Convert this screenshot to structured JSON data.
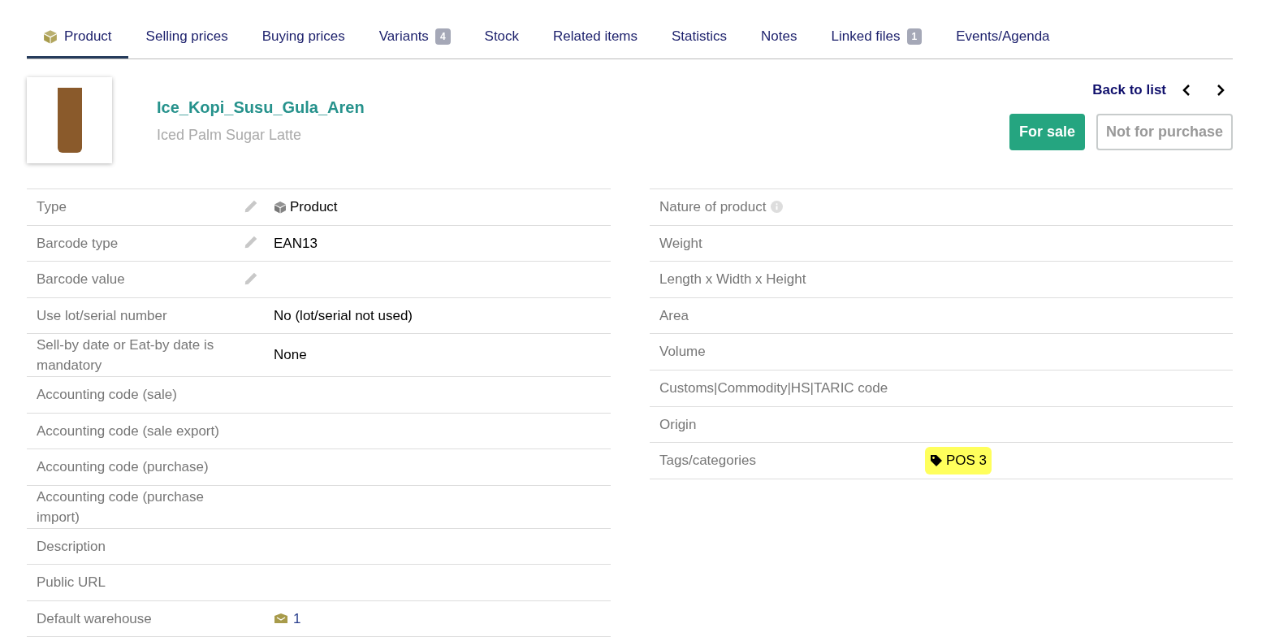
{
  "tabs": [
    {
      "label": "Product",
      "selected": true
    },
    {
      "label": "Selling prices",
      "selected": false
    },
    {
      "label": "Buying prices",
      "selected": false
    },
    {
      "label": "Variants",
      "badge": "4",
      "selected": false
    },
    {
      "label": "Stock",
      "selected": false
    },
    {
      "label": "Related items",
      "selected": false
    },
    {
      "label": "Statistics",
      "selected": false
    },
    {
      "label": "Notes",
      "selected": false
    },
    {
      "label": "Linked files",
      "badge": "1",
      "selected": false
    },
    {
      "label": "Events/Agenda",
      "selected": false
    }
  ],
  "product": {
    "ref": "Ice_Kopi_Susu_Gula_Aren",
    "label": "Iced Palm Sugar Latte"
  },
  "nav": {
    "back": "Back to list"
  },
  "status": [
    {
      "label": "For sale",
      "on": true
    },
    {
      "label": "Not for purchase",
      "on": false
    }
  ],
  "left_fields": [
    {
      "label": "Type",
      "editable": true,
      "kind": "type",
      "value": "Product"
    },
    {
      "label": "Barcode type",
      "editable": true,
      "kind": "text",
      "value": "EAN13"
    },
    {
      "label": "Barcode value",
      "editable": true,
      "kind": "text"
    },
    {
      "label": "Use lot/serial number",
      "editable": false,
      "kind": "text",
      "value": "No (lot/serial not used)"
    },
    {
      "label": "Sell-by date or Eat-by date is mandatory",
      "editable": false,
      "kind": "text",
      "value": "None"
    },
    {
      "label": "Accounting code (sale)",
      "editable": false,
      "kind": "text"
    },
    {
      "label": "Accounting code (sale export)",
      "editable": false,
      "kind": "text"
    },
    {
      "label": "Accounting code (purchase)",
      "editable": false,
      "kind": "text"
    },
    {
      "label": "Accounting code (purchase import)",
      "editable": false,
      "kind": "text"
    },
    {
      "label": "Description",
      "editable": false,
      "kind": "text"
    },
    {
      "label": "Public URL",
      "editable": false,
      "kind": "text"
    },
    {
      "label": "Default warehouse",
      "editable": false,
      "kind": "warehouse",
      "value": "1"
    }
  ],
  "right_fields": [
    {
      "label": "Nature of product",
      "info": true,
      "kind": "text"
    },
    {
      "label": "Weight",
      "info": false,
      "kind": "text"
    },
    {
      "label": "Length x Width x Height",
      "info": false,
      "kind": "text"
    },
    {
      "label": "Area",
      "info": false,
      "kind": "text"
    },
    {
      "label": "Volume",
      "info": false,
      "kind": "text"
    },
    {
      "label": "Customs|Commodity|HS|TARIC code",
      "info": false,
      "kind": "text"
    },
    {
      "label": "Origin",
      "info": false,
      "kind": "text"
    },
    {
      "label": "Tags/categories",
      "info": false,
      "kind": "tags",
      "tags": [
        "POS 3"
      ]
    }
  ]
}
